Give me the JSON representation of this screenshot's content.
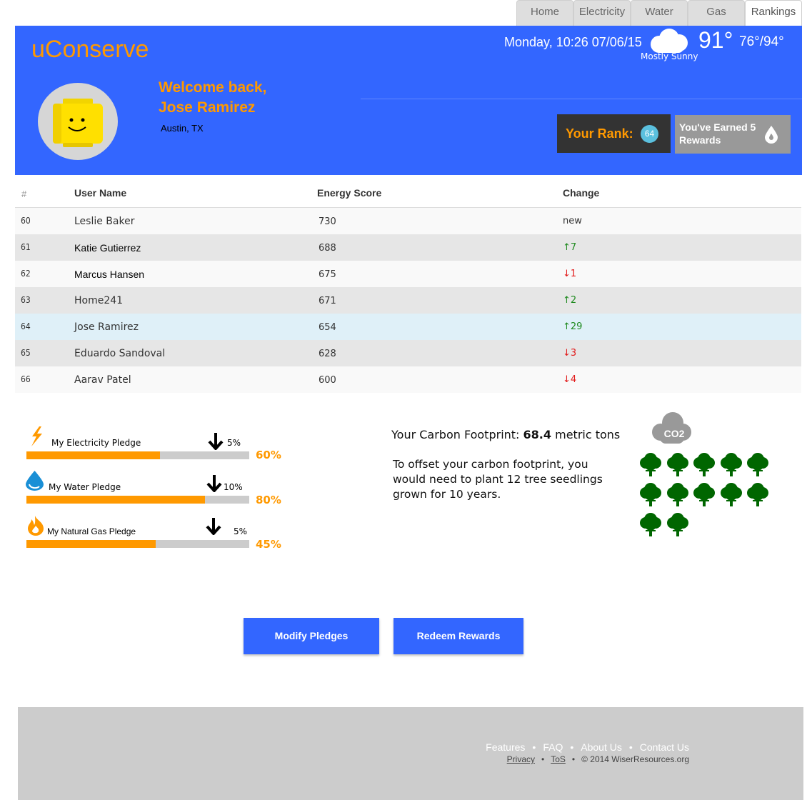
{
  "nav": {
    "tabs": [
      "Home",
      "Electricity",
      "Water",
      "Gas",
      "Rankings"
    ],
    "active_tab": "Rankings"
  },
  "header": {
    "logo": "uConserve",
    "welcome_line1": "Welcome back,",
    "welcome_line2": "Jose Ramirez",
    "location": "Austin, TX",
    "datetime": "Monday, 10:26 07/06/15",
    "weather_icon": "cloud-icon",
    "temperature": "91°",
    "hi_lo": "76°/94°",
    "condition": "Mostly Sunny",
    "rank_label": "Your Rank:",
    "rank_value": "64",
    "rewards_text": "You've Earned 5 Rewards",
    "rewards_icon": "water-drop-icon"
  },
  "table": {
    "columns": [
      "#",
      "User Name",
      "Energy Score",
      "Change"
    ],
    "rows": [
      {
        "rank": "60",
        "name": "Leslie Baker",
        "score": "730",
        "change": "new",
        "dir": "none"
      },
      {
        "rank": "61",
        "name": "Katie Gutierrez",
        "score": "688",
        "change": "↑7",
        "dir": "up"
      },
      {
        "rank": "62",
        "name": "Marcus Hansen",
        "score": "675",
        "change": "↓1",
        "dir": "down"
      },
      {
        "rank": "63",
        "name": "Home241",
        "score": "671",
        "change": "↑2",
        "dir": "up"
      },
      {
        "rank": "64",
        "name": "Jose Ramirez",
        "score": "654",
        "change": "↑29",
        "dir": "up"
      },
      {
        "rank": "65",
        "name": "Eduardo Sandoval",
        "score": "628",
        "change": "↓3",
        "dir": "down"
      },
      {
        "rank": "66",
        "name": "Aarav Patel",
        "score": "600",
        "change": "↓4",
        "dir": "down"
      }
    ],
    "highlight_rank": "64"
  },
  "pledges": [
    {
      "label": "My Electricity Pledge",
      "icon": "lightning-icon",
      "target": "5%",
      "progress": 0.6,
      "percent": "60%"
    },
    {
      "label": "My Water Pledge",
      "icon": "water-drop-icon",
      "target": "10%",
      "progress": 0.8,
      "percent": "80%"
    },
    {
      "label": "My Natural Gas Pledge",
      "icon": "flame-icon",
      "target": "5%",
      "progress": 0.58,
      "percent": "45%"
    }
  ],
  "carbon": {
    "title_prefix": "Your Carbon Footprint:",
    "value": "68.4",
    "unit": "metric tons",
    "text": "To offset your carbon footprint, you would need to plant 12 tree seedlings grown for 10 years.",
    "co2_label": "CO2",
    "tree_count": 12
  },
  "actions": {
    "modify": "Modify Pledges",
    "redeem": "Redeem Rewards"
  },
  "footer": {
    "links": [
      "Features",
      "FAQ",
      "About Us",
      "Contact Us"
    ],
    "legal": [
      "Privacy",
      "ToS"
    ],
    "copyright": "© 2014 WiserResources.org",
    "separator": "•"
  },
  "colors": {
    "brand_blue": "#3366ff",
    "accent_orange": "#ff9900",
    "tree_green": "#006600",
    "up_green": "#1f8a1f",
    "down_red": "#e21b1b"
  }
}
